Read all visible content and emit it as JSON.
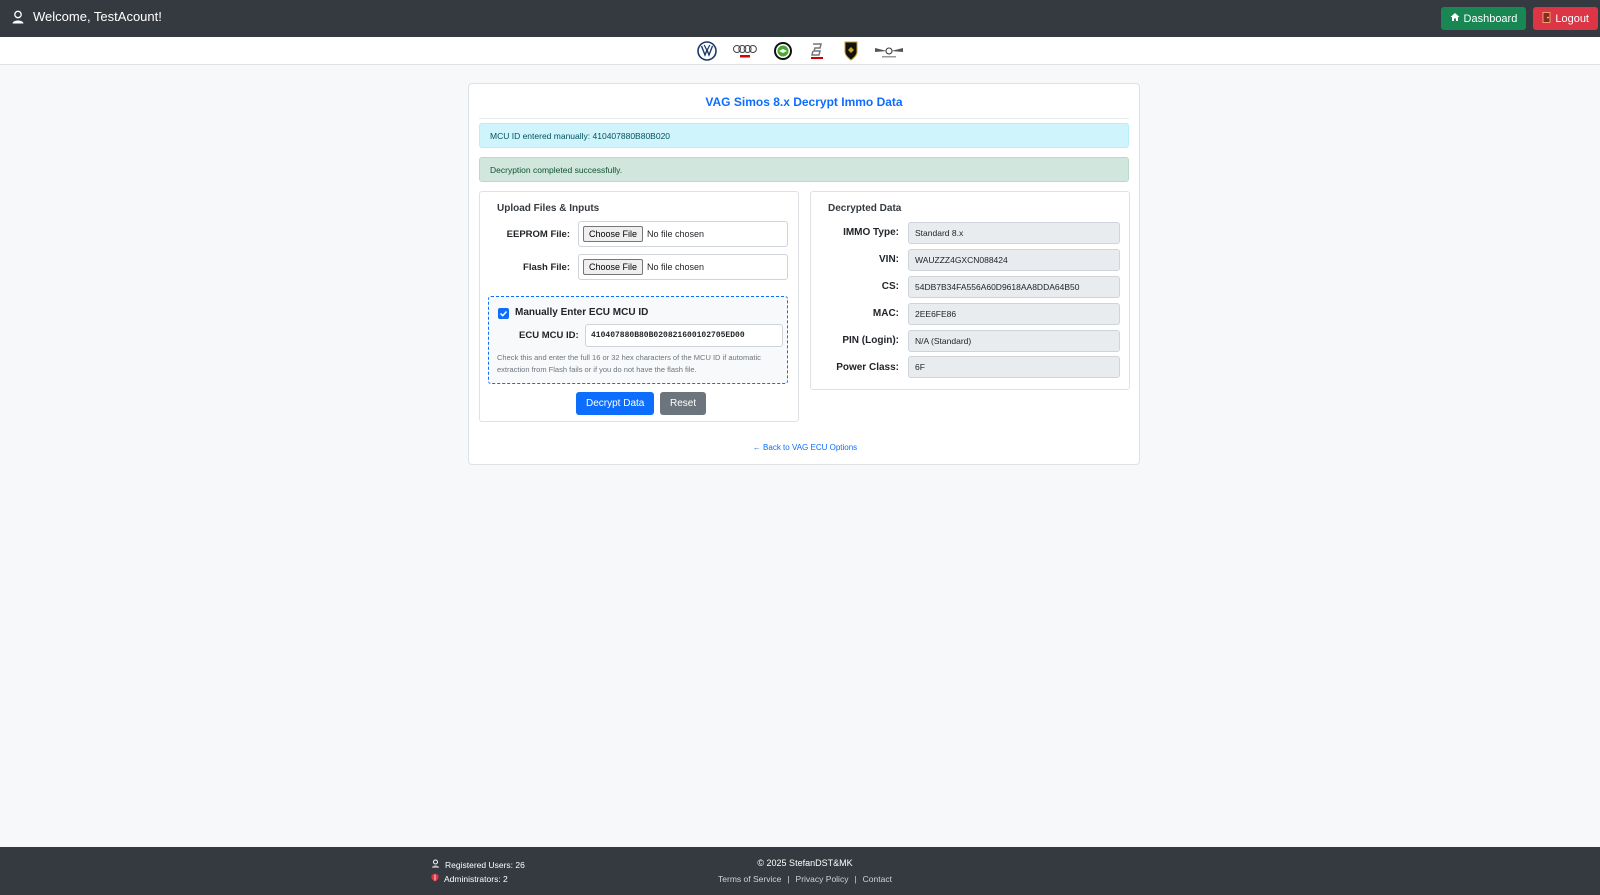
{
  "header": {
    "welcome_text": "Welcome, TestAcount!",
    "dashboard_label": "Dashboard",
    "logout_label": "Logout",
    "icons": [
      "user-icon",
      "home-icon",
      "door-icon"
    ],
    "colors": {
      "navbar": "#343a40",
      "dashboard": "#198754",
      "logout": "#dc3545"
    }
  },
  "brands": [
    "volkswagen-logo",
    "audi-logo",
    "skoda-logo",
    "seat-logo",
    "lamborghini-logo",
    "bentley-logo"
  ],
  "card": {
    "title": "VAG Simos 8.x Decrypt Immo Data",
    "alert_info": "MCU ID entered manually: 410407880B80B020",
    "alert_success": "Decryption completed successfully.",
    "back_link": "← Back to VAG ECU Options"
  },
  "upload": {
    "heading": "Upload Files & Inputs",
    "eeprom_label": "EEPROM File:",
    "flash_label": "Flash File:",
    "choose_file": "Choose File",
    "no_file": "No file chosen",
    "manual_label": "Manually Enter ECU MCU ID",
    "manual_checked": true,
    "mcu_label": "ECU MCU ID:",
    "mcu_value": "410407880B80B020821600102705ED00",
    "hint": "Check this and enter the full 16 or 32 hex characters of the MCU ID if automatic extraction from Flash fails or if you do not have the flash file.",
    "decrypt_button": "Decrypt Data",
    "reset_button": "Reset"
  },
  "decrypted": {
    "heading": "Decrypted Data",
    "rows": [
      {
        "label": "IMMO Type:",
        "value": "Standard 8.x"
      },
      {
        "label": "VIN:",
        "value": "WAUZZZ4GXCN088424"
      },
      {
        "label": "CS:",
        "value": "54DB7B34FA556A60D9618AA8DDA64B50"
      },
      {
        "label": "MAC:",
        "value": "2EE6FE86"
      },
      {
        "label": "PIN (Login):",
        "value": "N/A (Standard)"
      },
      {
        "label": "Power Class:",
        "value": "6F"
      }
    ]
  },
  "footer": {
    "registered": "Registered Users: 26",
    "admins": "Administrators: 2",
    "copyright": "© 2025 StefanDST&MK",
    "terms": "Terms of Service",
    "privacy": "Privacy Policy",
    "contact": "Contact",
    "separator": "|"
  }
}
